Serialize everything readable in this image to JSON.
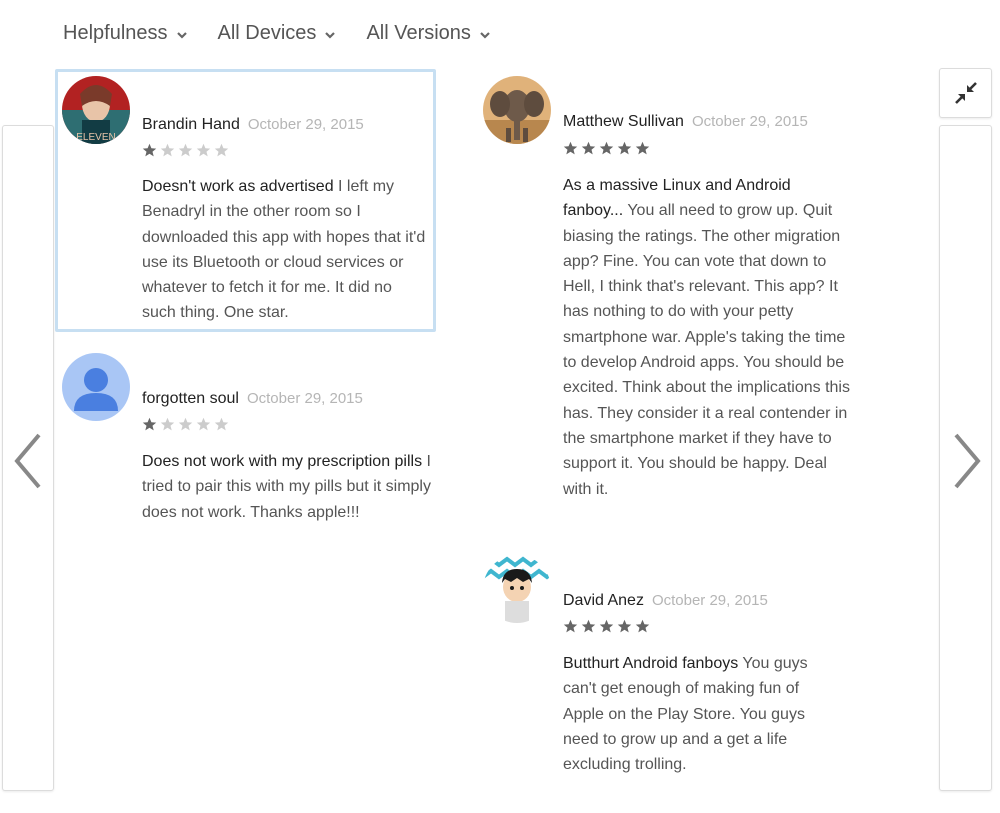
{
  "filters": [
    {
      "label": "Helpfulness"
    },
    {
      "label": "All Devices"
    },
    {
      "label": "All Versions"
    }
  ],
  "icons": {
    "left_arrow": "chevron-left-icon",
    "right_arrow": "chevron-right-icon",
    "collapse": "collapse-icon",
    "filter_chevron": "chevron-down-icon",
    "star": "star-icon"
  },
  "colors": {
    "star_filled": "#666666",
    "star_empty": "#cccccc",
    "selected_border": "#c7dff2"
  },
  "reviews": [
    {
      "author": "Brandin Hand",
      "date": "October 29, 2015",
      "rating": 1,
      "title": "Doesn't work as advertised",
      "text": " I left my Benadryl in the other room so I downloaded this app with hopes that it'd use its Bluetooth or cloud services or whatever to fetch it for me. It did no such thing. One star.",
      "avatar_text": "ELEVEN"
    },
    {
      "author": "forgotten soul",
      "date": "October 29, 2015",
      "rating": 1,
      "title": "Does not work with my prescription pills",
      "text": " I tried to pair this with my pills but it simply does not work. Thanks apple!!!"
    },
    {
      "author": "Matthew Sullivan",
      "date": "October 29, 2015",
      "rating": 5,
      "title": "As a massive Linux and Android fanboy...",
      "text": " You all need to grow up. Quit biasing the ratings. The other migration app? Fine. You can vote that down to Hell, I think that's relevant. This app? It has nothing to do with your petty smartphone war. Apple's taking the time to develop Android apps. You should be excited. Think about the implications this has. They consider it a real contender in the smartphone market if they have to support it. You should be happy. Deal with it."
    },
    {
      "author": "David Anez",
      "date": "October 29, 2015",
      "rating": 5,
      "title": "Butthurt Android fanboys",
      "text": " You guys can't get enough of making fun of Apple on the Play Store. You guys need to grow up and a get a life excluding trolling."
    }
  ]
}
